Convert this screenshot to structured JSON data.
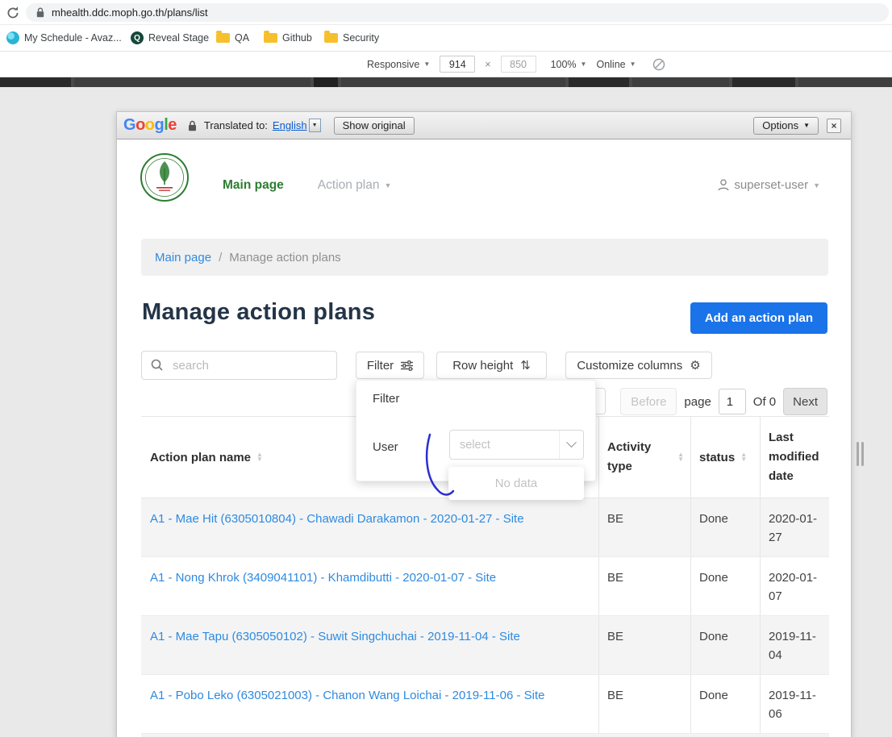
{
  "browser": {
    "url": "mhealth.ddc.moph.go.th/plans/list",
    "bookmarks": [
      {
        "label": "My Schedule - Avaz..."
      },
      {
        "label": "Reveal Stage"
      },
      {
        "label": "QA"
      },
      {
        "label": "Github"
      },
      {
        "label": "Security"
      }
    ],
    "devtools": {
      "device": "Responsive",
      "width": "914",
      "times": "×",
      "height": "850",
      "zoom": "100%",
      "network": "Online"
    }
  },
  "translate_bar": {
    "brand": "Google",
    "translated_label": "Translated to:",
    "language": "English",
    "show_original": "Show original",
    "options": "Options",
    "close": "×"
  },
  "site_header": {
    "nav_main": "Main page",
    "nav_action": "Action plan",
    "user": "superset-user"
  },
  "breadcrumb": {
    "link": "Main page",
    "separator": "/",
    "current": "Manage action plans"
  },
  "page": {
    "title": "Manage action plans",
    "add_button": "Add an action plan",
    "search_placeholder": "search"
  },
  "toolbar": {
    "filter": "Filter",
    "row_height": "Row height",
    "customize": "Customize columns"
  },
  "filter_panel": {
    "title": "Filter",
    "user_label": "User",
    "select_placeholder": "select",
    "no_data": "No data"
  },
  "pagination": {
    "before": "Before",
    "page_label": "page",
    "page_value": "1",
    "of_label": "Of 0",
    "next": "Next"
  },
  "table": {
    "columns": [
      "Action plan name",
      "Activity type",
      "status",
      "Last modified date"
    ],
    "rows": [
      {
        "name": "A1 - Mae Hit (6305010804) - Chawadi Darakamon - 2020-01-27 - Site",
        "type": "BE",
        "status": "Done",
        "modified": "2020-01-27"
      },
      {
        "name": "A1 - Nong Khrok (3409041101) - Khamdibutti - 2020-01-07 - Site",
        "type": "BE",
        "status": "Done",
        "modified": "2020-01-07"
      },
      {
        "name": "A1 - Mae Tapu (6305050102) - Suwit Singchuchai - 2019-11-04 - Site",
        "type": "BE",
        "status": "Done",
        "modified": "2019-11-04"
      },
      {
        "name": "A1 - Pobo Leko (6305021003) - Chanon Wang Loichai - 2019-11-06 - Site",
        "type": "BE",
        "status": "Done",
        "modified": "2019-11-06"
      }
    ]
  },
  "icons": {
    "caret": "▼",
    "sort_up": "▲",
    "sort_down": "▼",
    "gear": "⚙",
    "row_height": "⇅",
    "reveal": "Q"
  },
  "colors": {
    "accent_blue": "#1a73e8",
    "link_blue": "#2e8ae0",
    "brand_green": "#2e7d32"
  }
}
